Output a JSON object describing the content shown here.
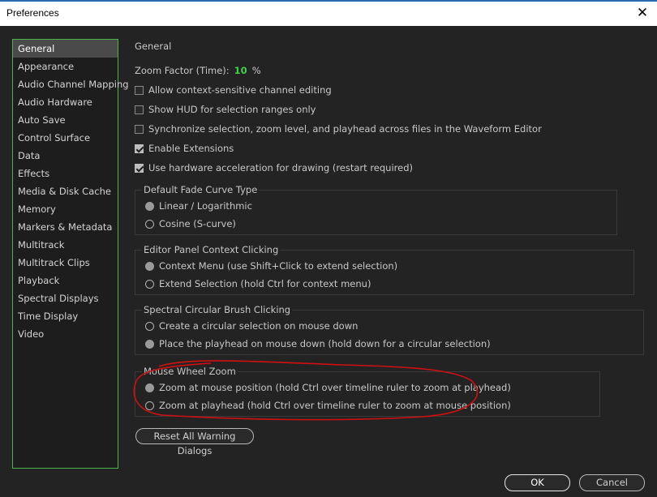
{
  "window": {
    "title": "Preferences",
    "close_icon": "close-icon"
  },
  "sidebar": {
    "items": [
      {
        "label": "General",
        "selected": true
      },
      {
        "label": "Appearance"
      },
      {
        "label": "Audio Channel Mapping"
      },
      {
        "label": "Audio Hardware"
      },
      {
        "label": "Auto Save"
      },
      {
        "label": "Control Surface"
      },
      {
        "label": "Data"
      },
      {
        "label": "Effects"
      },
      {
        "label": "Media & Disk Cache"
      },
      {
        "label": "Memory"
      },
      {
        "label": "Markers & Metadata"
      },
      {
        "label": "Multitrack"
      },
      {
        "label": "Multitrack Clips"
      },
      {
        "label": "Playback"
      },
      {
        "label": "Spectral Displays"
      },
      {
        "label": "Time Display"
      },
      {
        "label": "Video"
      }
    ]
  },
  "general": {
    "section_title": "General",
    "zoom_factor_label": "Zoom Factor (Time):",
    "zoom_factor_value": "10",
    "zoom_factor_unit": "%",
    "checkboxes": [
      {
        "label": "Allow context-sensitive channel editing",
        "checked": false
      },
      {
        "label": "Show HUD for selection ranges only",
        "checked": false
      },
      {
        "label": "Synchronize selection, zoom level, and playhead across files in the Waveform Editor",
        "checked": false
      },
      {
        "label": "Enable Extensions",
        "checked": true
      },
      {
        "label": "Use hardware acceleration for drawing (restart required)",
        "checked": true
      }
    ],
    "fade_curve": {
      "title": "Default Fade Curve Type",
      "options": [
        {
          "label": "Linear / Logarithmic",
          "selected": true
        },
        {
          "label": "Cosine (S-curve)",
          "selected": false
        }
      ]
    },
    "editor_click": {
      "title": "Editor Panel Context Clicking",
      "options": [
        {
          "label": "Context Menu (use Shift+Click to extend selection)",
          "selected": true
        },
        {
          "label": "Extend Selection (hold Ctrl for context menu)",
          "selected": false
        }
      ]
    },
    "spectral_brush": {
      "title": "Spectral Circular Brush Clicking",
      "options": [
        {
          "label": "Create a circular selection on mouse down",
          "selected": false
        },
        {
          "label": "Place the playhead on mouse down (hold down for a circular selection)",
          "selected": true
        }
      ]
    },
    "mouse_wheel": {
      "title": "Mouse Wheel Zoom",
      "options": [
        {
          "label": "Zoom at mouse position (hold Ctrl over timeline ruler to zoom at playhead)",
          "selected": true
        },
        {
          "label": "Zoom at playhead (hold Ctrl over timeline ruler to zoom at mouse position)",
          "selected": false
        }
      ]
    },
    "reset_button": "Reset All Warning Dialogs"
  },
  "footer": {
    "ok": "OK",
    "cancel": "Cancel"
  },
  "colors": {
    "accent_green": "#3fd24a",
    "annotation_red": "#d01010",
    "sidebar_border": "#4ab54a"
  }
}
